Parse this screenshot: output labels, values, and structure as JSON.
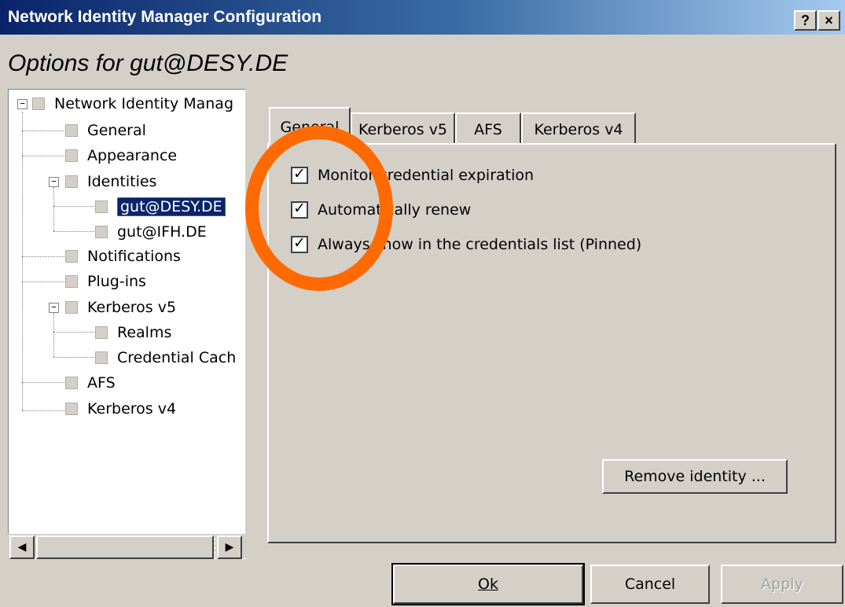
{
  "window": {
    "title": "Network Identity Manager Configuration",
    "help_button": "?",
    "close_button": "×"
  },
  "heading": "Options for gut@DESY.DE",
  "tree": {
    "root": "Network Identity Manag",
    "items": [
      {
        "label": "General"
      },
      {
        "label": "Appearance"
      },
      {
        "label": "Identities"
      },
      {
        "label": "gut@DESY.DE",
        "selected": true
      },
      {
        "label": "gut@IFH.DE"
      },
      {
        "label": "Notifications"
      },
      {
        "label": "Plug-ins"
      },
      {
        "label": "Kerberos v5"
      },
      {
        "label": "Realms"
      },
      {
        "label": "Credential Cach"
      },
      {
        "label": "AFS"
      },
      {
        "label": "Kerberos v4"
      }
    ]
  },
  "tabs": [
    {
      "label": "General",
      "active": true
    },
    {
      "label": "Kerberos v5"
    },
    {
      "label": "AFS"
    },
    {
      "label": "Kerberos v4"
    }
  ],
  "options": [
    {
      "label": "Monitor credential expiration",
      "checked": true
    },
    {
      "label": "Automatically renew",
      "checked": true
    },
    {
      "label": "Always show in the credentials list (Pinned)",
      "checked": true
    }
  ],
  "buttons": {
    "remove_identity": "Remove identity ...",
    "ok": "Ok",
    "cancel": "Cancel",
    "apply": "Apply"
  },
  "colors": {
    "highlight_circle": "#ff6a00",
    "titlebar": "#0a246a",
    "selection": "#0a246a"
  }
}
